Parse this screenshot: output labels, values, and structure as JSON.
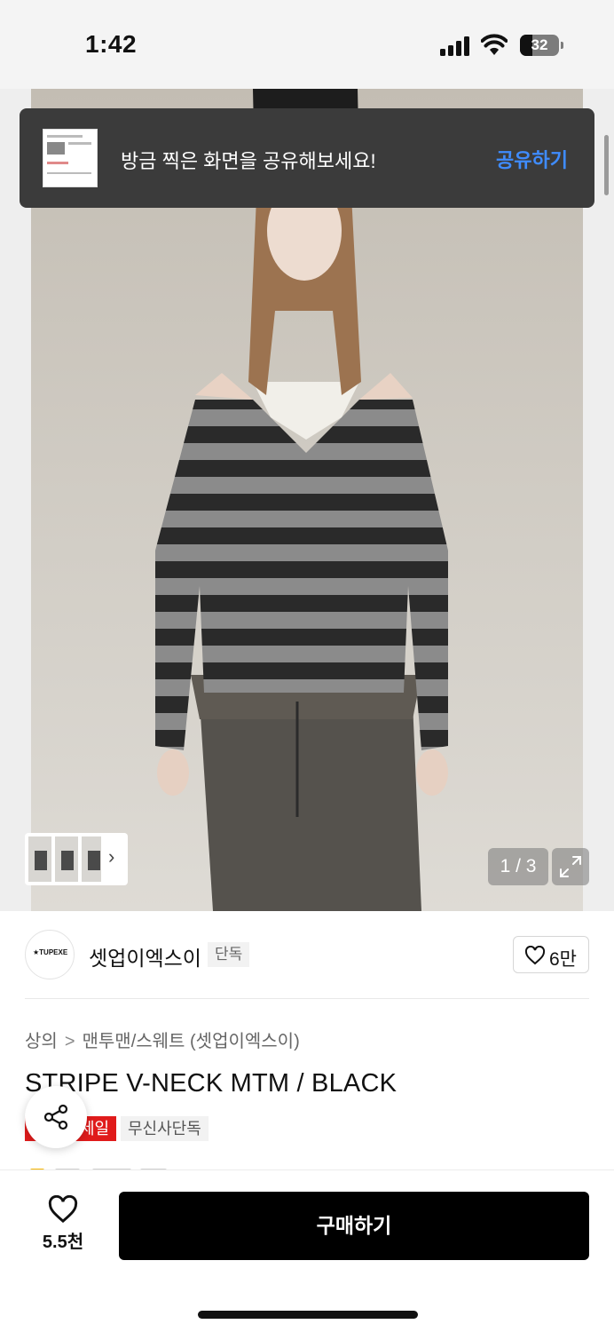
{
  "status_bar": {
    "time": "1:42",
    "battery": "32"
  },
  "toast": {
    "message": "방금 찍은 화면을 공유해보세요!",
    "action": "공유하기"
  },
  "gallery": {
    "counter": "1 / 3"
  },
  "brand": {
    "logo_text": "★TUPEXE",
    "name": "셋업이엑스이",
    "tag": "단독",
    "likes": "6만"
  },
  "breadcrumb": {
    "category": "상의",
    "separator": ">",
    "subcategory": "맨투맨/스웨트 (셋업이엑스이)"
  },
  "product": {
    "title": "STRIPE V-NECK MTM / BLACK",
    "sale_badge": "세일",
    "exclusive_badge": "무신사단독"
  },
  "bottom_bar": {
    "wish_count": "5.5천",
    "buy_label": "구매하기"
  },
  "colors": {
    "accent": "#3f8cff",
    "sale": "#e01b1b",
    "buy_button": "#000000",
    "toast_bg": "#3b3b3b"
  },
  "icons": [
    "signal-icon",
    "wifi-icon",
    "battery-icon",
    "chevron-right-icon",
    "expand-icon",
    "heart-icon",
    "share-icon"
  ]
}
